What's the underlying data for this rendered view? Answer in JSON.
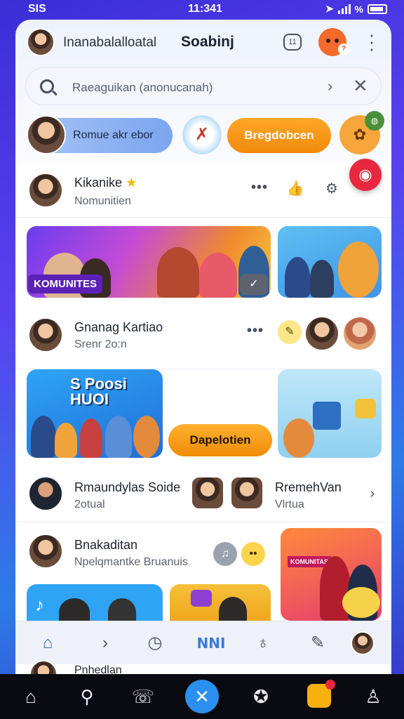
{
  "status_bar": {
    "left": "SIS",
    "time": "11:341",
    "right": "%"
  },
  "header": {
    "user_name": "Inanabalalloatal",
    "title": "Soabinj",
    "chat_icon_text": "11"
  },
  "search": {
    "placeholder": "Raeaguikan (anonucanah)"
  },
  "chips": {
    "user_chip_label": "Romue akr ebor",
    "orange_chip_label": "Bregdobcen"
  },
  "feed": {
    "post1": {
      "name": "Kikanike",
      "sub": "Nomunitien",
      "dots": "•••"
    },
    "tile1_label": "KOMUNITES",
    "post2": {
      "name": "Gnanag Kartiao",
      "sub": "Srenr 2o:n",
      "dots": "•••"
    },
    "poster_title": "S Poosi HUOI",
    "orange_button_label": "Dapelotien",
    "post3": {
      "name": "Rmaundylas Soide",
      "sub": "2otual",
      "right_name": "RremehVan",
      "right_sub": "Vlrtua"
    },
    "post4": {
      "name": "Bnakaditan",
      "sub": "Npelqmantke Bruanuis"
    },
    "promo_banner_text": "KOMUNITAS"
  },
  "inner_nav": {
    "text_item": "NNI"
  },
  "preview": {
    "name": "Pnhedlan"
  },
  "colors": {
    "accent_blue": "#2b8ff0",
    "orange": "#f28a09",
    "red_fab": "#e8283f"
  }
}
